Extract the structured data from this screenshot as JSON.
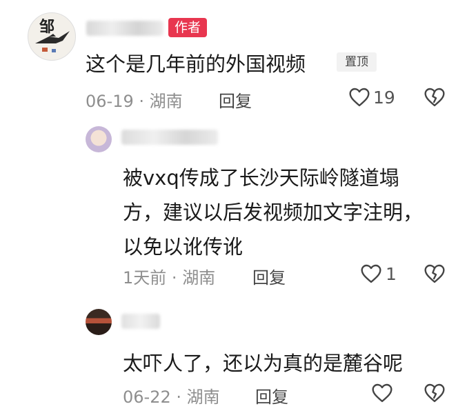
{
  "comments": [
    {
      "author_badge": "作者",
      "text": "这个是几年前的外国视频",
      "pinned_badge": "置顶",
      "date": "06-19",
      "location": "湖南",
      "reply_label": "回复",
      "likes": "19"
    },
    {
      "text_lines": [
        "被vxq传成了长沙天际岭隧道塌",
        "方，建议以后发视频加文字注明，",
        "以免以讹传讹"
      ],
      "date": "1天前",
      "location": "湖南",
      "reply_label": "回复",
      "likes": "1"
    },
    {
      "text": "太吓人了，还以为真的是麓谷呢",
      "date": "06-22",
      "location": "湖南",
      "reply_label": "回复"
    }
  ],
  "avatar1_char": "邹",
  "icons": {
    "like": "heart-outline-icon",
    "dislike": "broken-heart-icon"
  },
  "colors": {
    "author_badge_bg": "#e8364f",
    "meta": "#8e8e8e",
    "pinned_bg": "#f2f2f2"
  }
}
